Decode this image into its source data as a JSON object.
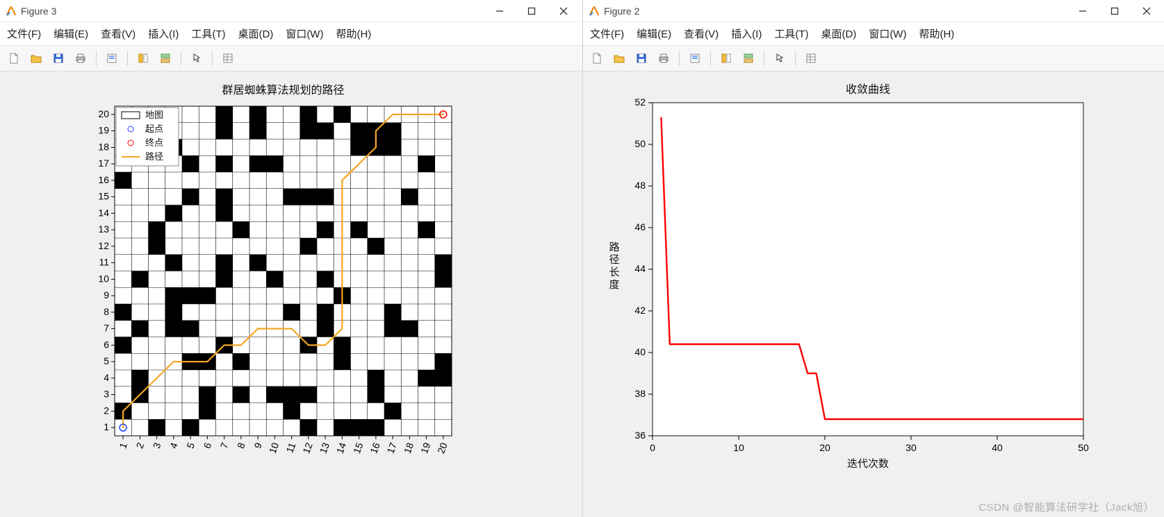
{
  "watermark": "CSDN @智能算法研学社（Jack旭）",
  "win1": {
    "title": "Figure 3",
    "menu": [
      "文件(F)",
      "编辑(E)",
      "查看(V)",
      "插入(I)",
      "工具(T)",
      "桌面(D)",
      "窗口(W)",
      "帮助(H)"
    ],
    "toolbar_icons": [
      "new-file",
      "open-file",
      "save",
      "print",
      "|",
      "print-preview",
      "|",
      "data-cursor",
      "brush",
      "|",
      "pointer",
      "|",
      "inspector"
    ]
  },
  "win2": {
    "title": "Figure 2",
    "menu": [
      "文件(F)",
      "编辑(E)",
      "查看(V)",
      "插入(I)",
      "工具(T)",
      "桌面(D)",
      "窗口(W)",
      "帮助(H)"
    ],
    "toolbar_icons": [
      "new-file",
      "open-file",
      "save",
      "print",
      "|",
      "print-preview",
      "|",
      "data-cursor",
      "brush",
      "|",
      "pointer",
      "|",
      "inspector"
    ]
  },
  "chart_data": [
    {
      "id": "path_map",
      "type": "heatmap",
      "title": "群居蜘蛛算法规划的路径",
      "xlabel": "",
      "ylabel": "",
      "grid_size": 20,
      "xticks": [
        1,
        2,
        3,
        4,
        5,
        6,
        7,
        8,
        9,
        10,
        11,
        12,
        13,
        14,
        15,
        16,
        17,
        18,
        19,
        20
      ],
      "yticks": [
        1,
        2,
        3,
        4,
        5,
        6,
        7,
        8,
        9,
        10,
        11,
        12,
        13,
        14,
        15,
        16,
        17,
        18,
        19,
        20
      ],
      "legend": [
        "地图",
        "起点",
        "终点",
        "路径"
      ],
      "start": [
        1,
        1
      ],
      "end": [
        20,
        20
      ],
      "obstacles": [
        [
          3,
          1
        ],
        [
          5,
          1
        ],
        [
          12,
          1
        ],
        [
          14,
          1
        ],
        [
          15,
          1
        ],
        [
          16,
          1
        ],
        [
          1,
          2
        ],
        [
          6,
          2
        ],
        [
          11,
          2
        ],
        [
          17,
          2
        ],
        [
          2,
          3
        ],
        [
          6,
          3
        ],
        [
          8,
          3
        ],
        [
          10,
          3
        ],
        [
          11,
          3
        ],
        [
          12,
          3
        ],
        [
          16,
          3
        ],
        [
          2,
          4
        ],
        [
          16,
          4
        ],
        [
          19,
          4
        ],
        [
          20,
          4
        ],
        [
          5,
          5
        ],
        [
          6,
          5
        ],
        [
          8,
          5
        ],
        [
          14,
          5
        ],
        [
          20,
          5
        ],
        [
          1,
          6
        ],
        [
          7,
          6
        ],
        [
          12,
          6
        ],
        [
          14,
          6
        ],
        [
          2,
          7
        ],
        [
          4,
          7
        ],
        [
          5,
          7
        ],
        [
          13,
          7
        ],
        [
          17,
          7
        ],
        [
          18,
          7
        ],
        [
          1,
          8
        ],
        [
          4,
          8
        ],
        [
          11,
          8
        ],
        [
          13,
          8
        ],
        [
          17,
          8
        ],
        [
          4,
          9
        ],
        [
          5,
          9
        ],
        [
          6,
          9
        ],
        [
          14,
          9
        ],
        [
          2,
          10
        ],
        [
          7,
          10
        ],
        [
          10,
          10
        ],
        [
          13,
          10
        ],
        [
          20,
          10
        ],
        [
          4,
          11
        ],
        [
          7,
          11
        ],
        [
          9,
          11
        ],
        [
          20,
          11
        ],
        [
          3,
          12
        ],
        [
          12,
          12
        ],
        [
          16,
          12
        ],
        [
          3,
          13
        ],
        [
          8,
          13
        ],
        [
          13,
          13
        ],
        [
          15,
          13
        ],
        [
          19,
          13
        ],
        [
          4,
          14
        ],
        [
          7,
          14
        ],
        [
          5,
          15
        ],
        [
          7,
          15
        ],
        [
          11,
          15
        ],
        [
          12,
          15
        ],
        [
          13,
          15
        ],
        [
          18,
          15
        ],
        [
          1,
          16
        ],
        [
          5,
          17
        ],
        [
          7,
          17
        ],
        [
          9,
          17
        ],
        [
          10,
          17
        ],
        [
          19,
          17
        ],
        [
          4,
          18
        ],
        [
          15,
          18
        ],
        [
          16,
          18
        ],
        [
          17,
          18
        ],
        [
          3,
          19
        ],
        [
          7,
          19
        ],
        [
          9,
          19
        ],
        [
          12,
          19
        ],
        [
          13,
          19
        ],
        [
          15,
          19
        ],
        [
          16,
          19
        ],
        [
          17,
          19
        ],
        [
          7,
          20
        ],
        [
          9,
          20
        ],
        [
          12,
          20
        ],
        [
          14,
          20
        ]
      ],
      "path": [
        [
          1,
          1
        ],
        [
          1,
          2
        ],
        [
          2,
          3
        ],
        [
          3,
          4
        ],
        [
          4,
          5
        ],
        [
          5,
          5
        ],
        [
          6,
          5
        ],
        [
          7,
          6
        ],
        [
          8,
          6
        ],
        [
          9,
          7
        ],
        [
          10,
          7
        ],
        [
          11,
          7
        ],
        [
          12,
          6
        ],
        [
          13,
          6
        ],
        [
          14,
          7
        ],
        [
          14,
          8
        ],
        [
          14,
          9
        ],
        [
          14,
          10
        ],
        [
          14,
          11
        ],
        [
          14,
          12
        ],
        [
          14,
          13
        ],
        [
          14,
          14
        ],
        [
          14,
          15
        ],
        [
          14,
          16
        ],
        [
          15,
          17
        ],
        [
          16,
          18
        ],
        [
          16,
          19
        ],
        [
          17,
          20
        ],
        [
          18,
          20
        ],
        [
          19,
          20
        ],
        [
          20,
          20
        ]
      ]
    },
    {
      "id": "convergence",
      "type": "line",
      "title": "收敛曲线",
      "xlabel": "迭代次数",
      "ylabel": "路径长度",
      "xlim": [
        0,
        50
      ],
      "ylim": [
        36,
        52
      ],
      "xticks": [
        0,
        10,
        20,
        30,
        40,
        50
      ],
      "yticks": [
        36,
        38,
        40,
        42,
        44,
        46,
        48,
        50,
        52
      ],
      "series": [
        {
          "name": "路径长度",
          "color": "#ff0000",
          "x": [
            1,
            2,
            3,
            17,
            18,
            19,
            20,
            21,
            50
          ],
          "y": [
            51.3,
            40.4,
            40.4,
            40.4,
            39.0,
            39.0,
            36.8,
            36.8,
            36.8
          ]
        }
      ]
    }
  ]
}
